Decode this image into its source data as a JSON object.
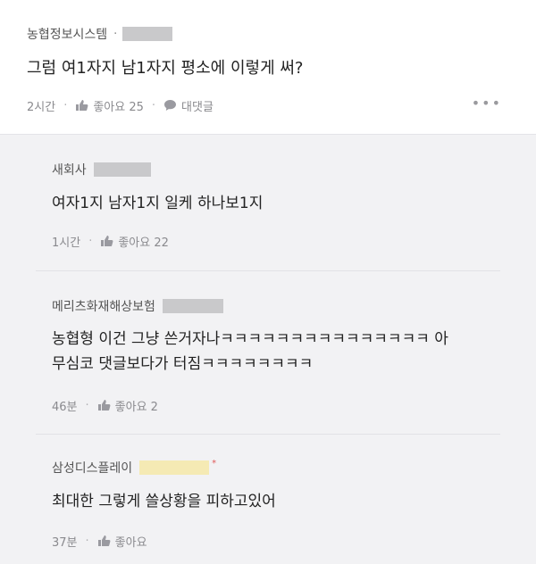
{
  "post": {
    "author": "농협정보시스템",
    "separator": "·",
    "text": "그럼 여1자지 남1자지 평소에 이렇게 써?",
    "time": "2시간",
    "like_label": "좋아요 25",
    "reply_label": "대댓글",
    "more": "•••"
  },
  "replies": [
    {
      "author": "새회사",
      "lines": [
        "여자1지 남자1지 일케 하나보1지"
      ],
      "time": "1시간",
      "like_label": "좋아요 22"
    },
    {
      "author": "메리츠화재해상보험",
      "lines": [
        "농협형 이건 그냥 쓴거자나ㅋㅋㅋㅋㅋㅋㅋㅋㅋㅋㅋㅋㅋㅋㅋ 아",
        "무심코 댓글보다가 터짐ㅋㅋㅋㅋㅋㅋㅋㅋ"
      ],
      "time": "46분",
      "like_label": "좋아요 2"
    },
    {
      "author": "삼성디스플레이",
      "asterisk": "*",
      "lines": [
        "최대한 그렇게 쓸상황을 피하고있어"
      ],
      "time": "37분",
      "like_label": "좋아요"
    }
  ],
  "colors": {
    "redact_gray": "#c9c9cb",
    "redact_yellow": "#f5eab4",
    "page_bg": "#f2f2f4"
  }
}
